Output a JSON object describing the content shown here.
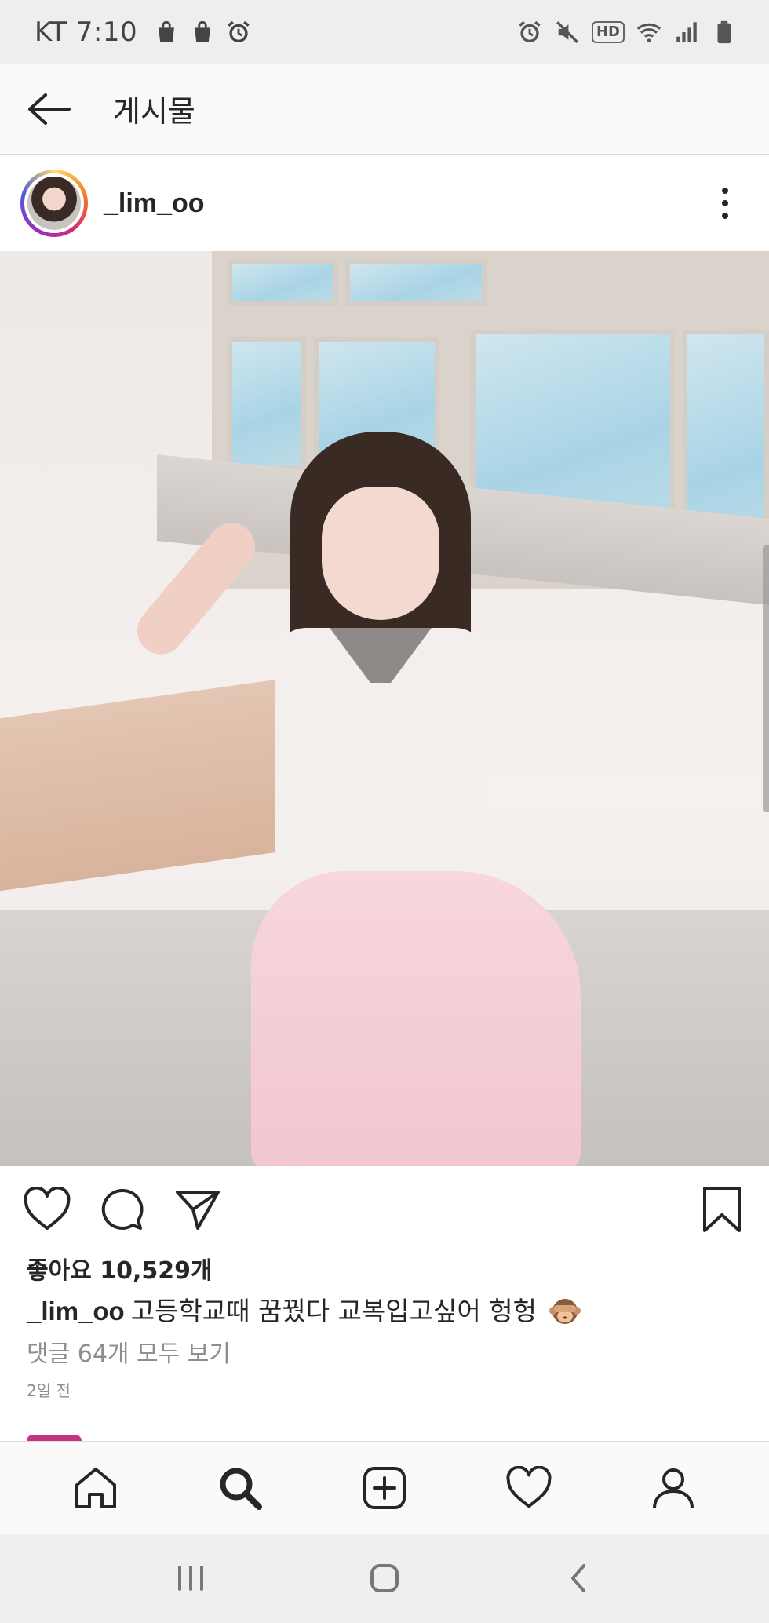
{
  "status_bar": {
    "carrier_time": "KT 7:10",
    "hd_label": "HD",
    "left_icons": [
      "shopping-bag-icon",
      "shopping-bag-icon",
      "alarm-icon"
    ],
    "right_icons": [
      "alarm-icon",
      "mute-icon",
      "hd-icon",
      "wifi-icon",
      "signal-icon",
      "battery-icon"
    ]
  },
  "header": {
    "title": "게시물",
    "back_icon": "back-arrow-icon"
  },
  "post": {
    "username": "_lim_oo",
    "likes_text": "좋아요 10,529개",
    "caption_user": "_lim_oo",
    "caption_text": "고등학교때 꿈꿨다 교복입고싶어 헝헝",
    "caption_emoji": "see-no-evil-monkey-emoji",
    "comments_link": "댓글 64개 모두 보기",
    "timestamp": "2일 전"
  },
  "colors": {
    "text": "#262626",
    "muted": "#8e8e8e",
    "divider": "#dbdbdb",
    "status_bg": "#eeeeee",
    "header_bg": "#fafafa"
  },
  "tab_bar": [
    "home-icon",
    "search-icon",
    "add-post-icon",
    "activity-heart-icon",
    "profile-icon"
  ],
  "system_nav": [
    "recent-apps-icon",
    "home-circle-icon",
    "back-chevron-icon"
  ]
}
